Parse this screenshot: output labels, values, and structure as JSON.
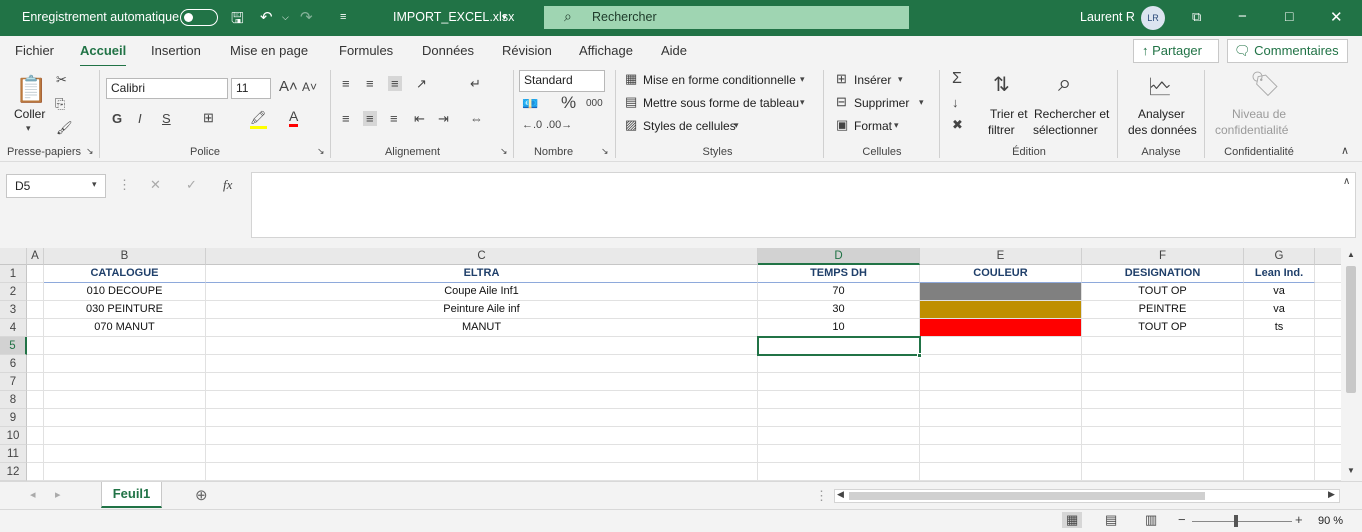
{
  "titlebar": {
    "autosave_label": "Enregistrement automatique",
    "filename": "IMPORT_EXCEL.xlsx",
    "search_placeholder": "Rechercher",
    "user_name": "Laurent R",
    "user_initials": "LR"
  },
  "tabs": [
    "Fichier",
    "Accueil",
    "Insertion",
    "Mise en page",
    "Formules",
    "Données",
    "Révision",
    "Affichage",
    "Aide"
  ],
  "active_tab": "Accueil",
  "share_label": "Partager",
  "comments_label": "Commentaires",
  "ribbon": {
    "clipboard": {
      "paste": "Coller",
      "label": "Presse-papiers"
    },
    "font": {
      "name": "Calibri",
      "size": "11",
      "bold": "G",
      "italic": "I",
      "underline": "S",
      "label": "Police"
    },
    "alignment": {
      "label": "Alignement"
    },
    "number": {
      "format": "Standard",
      "percent": "%",
      "thousands": "000",
      "label": "Nombre"
    },
    "styles": {
      "conditional": "Mise en forme conditionnelle",
      "table": "Mettre sous forme de tableau",
      "cell_styles": "Styles de cellules",
      "label": "Styles"
    },
    "cells": {
      "insert": "Insérer",
      "delete": "Supprimer",
      "format": "Format",
      "label": "Cellules"
    },
    "editing": {
      "sort_1": "Trier et",
      "sort_2": "filtrer",
      "find_1": "Rechercher et",
      "find_2": "sélectionner",
      "label": "Édition"
    },
    "analysis": {
      "btn_1": "Analyser",
      "btn_2": "des données",
      "label": "Analyse"
    },
    "sensitivity": {
      "btn_1": "Niveau de",
      "btn_2": "confidentialité",
      "label": "Confidentialité"
    }
  },
  "formula": {
    "namebox": "D5",
    "fx": "fx",
    "value": ""
  },
  "columns": [
    "A",
    "B",
    "C",
    "D",
    "E",
    "F",
    "G"
  ],
  "rows": [
    "1",
    "2",
    "3",
    "4",
    "5",
    "6",
    "7",
    "8",
    "9",
    "10",
    "11",
    "12"
  ],
  "header_row": [
    "",
    "CATALOGUE",
    "ELTRA",
    "TEMPS DH",
    "COULEUR",
    "DESIGNATION",
    "Lean Ind."
  ],
  "data_rows": [
    {
      "catalogue": "010 DECOUPE",
      "eltra": "Coupe Aile Inf1",
      "temps": "70",
      "couleur": "#808080",
      "designation": "TOUT OP",
      "lean": "va"
    },
    {
      "catalogue": "030 PEINTURE",
      "eltra": "Peinture Aile inf",
      "temps": "30",
      "couleur": "#bf8f00",
      "designation": "PEINTRE",
      "lean": "va"
    },
    {
      "catalogue": "070 MANUT",
      "eltra": "MANUT",
      "temps": "10",
      "couleur": "#ff0000",
      "designation": "TOUT OP",
      "lean": "ts"
    }
  ],
  "sheet_name": "Feuil1",
  "zoom": "90 %",
  "accent": "#217346"
}
